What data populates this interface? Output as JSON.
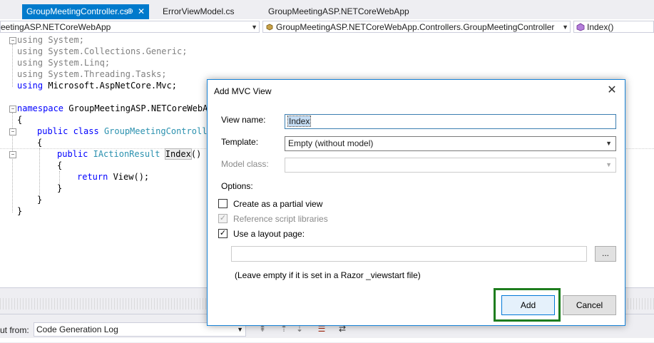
{
  "tabs": [
    {
      "label": "GroupMeetingController.cs",
      "pin": "⊕",
      "close": "✕"
    },
    {
      "label": "ErrorViewModel.cs"
    },
    {
      "label": "GroupMeetingASP.NETCoreWebApp"
    }
  ],
  "navbar": {
    "project": "eetingASP.NETCoreWebApp",
    "class": "GroupMeetingASP.NETCoreWebApp.Controllers.GroupMeetingController",
    "member": "Index()"
  },
  "code": {
    "l1": "using System;",
    "l2": "using System.Collections.Generic;",
    "l3": "using System.Linq;",
    "l4": "using System.Threading.Tasks;",
    "l5_kw": "using",
    "l5_rest": " Microsoft.AspNetCore.Mvc;",
    "l7_kw": "namespace",
    "l7_rest": " GroupMeetingASP.NETCoreWebAp",
    "l8": "{",
    "l9_kw": "public class",
    "l9_ty": "GroupMeetingControlle",
    "l10": "{",
    "l11_kw": "public",
    "l11_ty": "IActionResult",
    "l11_name": "Index",
    "l11_tail": "()",
    "l12": "{",
    "l13_kw": "return",
    "l13_rest": " View();",
    "l14": "}",
    "l15": "}",
    "l16": "}"
  },
  "output": {
    "from_label": "ut from:",
    "from_value": "Code Generation Log"
  },
  "dialog": {
    "title": "Add MVC View",
    "close": "✕",
    "view_name_label": "View name:",
    "view_name_value": "Index",
    "template_label": "Template:",
    "template_value": "Empty (without model)",
    "model_class_label": "Model class:",
    "model_class_value": "",
    "options_label": "Options:",
    "partial_label": "Create as a partial view",
    "partial_checked": false,
    "script_libs_label": "Reference script libraries",
    "script_libs_checked": true,
    "layout_label": "Use a layout page:",
    "layout_checked": true,
    "layout_path": "",
    "browse_label": "...",
    "hint": "(Leave empty if it is set in a Razor _viewstart file)",
    "add_label": "Add",
    "cancel_label": "Cancel"
  },
  "colors": {
    "accent": "#007acc",
    "highlight_border": "#1e7d1e",
    "keyword": "#0000ff",
    "type": "#2b91af"
  }
}
